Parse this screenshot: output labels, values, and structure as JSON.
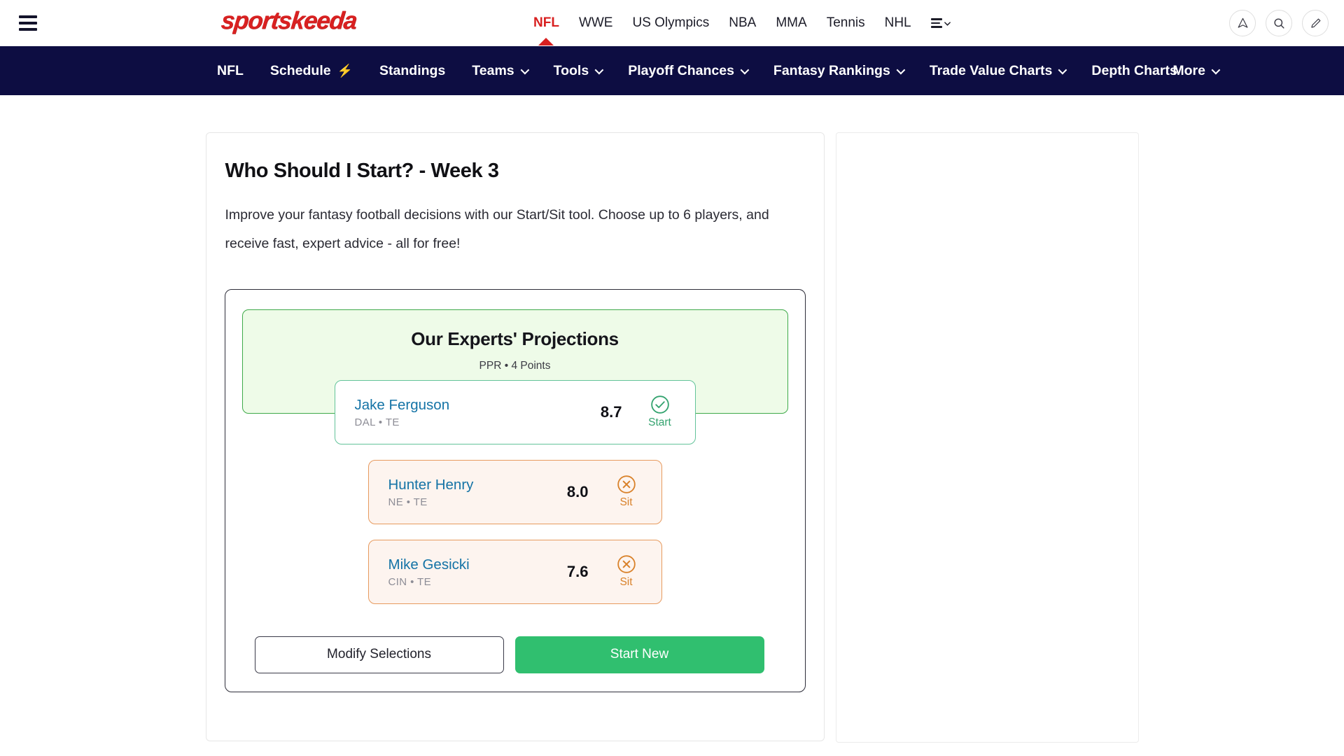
{
  "colors": {
    "brand_red": "#d92121",
    "navy": "#0d0d42",
    "green_accent": "#3faa4a",
    "green_button": "#30bf6f",
    "sit_orange": "#d9822b",
    "player_link_blue": "#1473a6"
  },
  "topbar": {
    "menu_icon": "hamburger-icon",
    "logo_text": "sportskeeda",
    "nav": [
      {
        "label": "NFL",
        "active": true
      },
      {
        "label": "WWE",
        "active": false
      },
      {
        "label": "US Olympics",
        "active": false
      },
      {
        "label": "NBA",
        "active": false
      },
      {
        "label": "MMA",
        "active": false
      },
      {
        "label": "Tennis",
        "active": false
      },
      {
        "label": "NHL",
        "active": false
      }
    ],
    "more_list_icon": "list-chevron-icon",
    "icons": [
      {
        "name": "notifications-icon",
        "glyph": "send"
      },
      {
        "name": "search-icon",
        "glyph": "search"
      },
      {
        "name": "write-icon",
        "glyph": "pencil"
      }
    ]
  },
  "navbar": {
    "items": [
      {
        "label": "NFL",
        "has_dropdown": false,
        "badge": ""
      },
      {
        "label": "Schedule",
        "has_dropdown": false,
        "badge": "⚡"
      },
      {
        "label": "Standings",
        "has_dropdown": false,
        "badge": ""
      },
      {
        "label": "Teams",
        "has_dropdown": true,
        "badge": ""
      },
      {
        "label": "Tools",
        "has_dropdown": true,
        "badge": ""
      },
      {
        "label": "Playoff Chances",
        "has_dropdown": true,
        "badge": ""
      },
      {
        "label": "Fantasy Rankings",
        "has_dropdown": true,
        "badge": ""
      },
      {
        "label": "Trade Value Charts",
        "has_dropdown": true,
        "badge": ""
      },
      {
        "label": "Depth Charts",
        "has_dropdown": false,
        "badge": ""
      }
    ],
    "more": {
      "label": "More",
      "has_dropdown": true
    }
  },
  "main": {
    "title": "Who Should I Start? - Week 3",
    "subtitle": "Improve your fantasy football decisions with our Start/Sit tool. Choose up to 6 players, and receive fast, expert advice - all for free!",
    "projections": {
      "heading": "Our Experts' Projections",
      "meta": "PPR • 4 Points",
      "players": [
        {
          "name": "Jake Ferguson",
          "team": "DAL",
          "position": "TE",
          "team_pos": "DAL • TE",
          "score": "8.7",
          "verdict": "Start",
          "verdict_icon": "check-circle-icon"
        },
        {
          "name": "Hunter Henry",
          "team": "NE",
          "position": "TE",
          "team_pos": "NE • TE",
          "score": "8.0",
          "verdict": "Sit",
          "verdict_icon": "x-circle-icon"
        },
        {
          "name": "Mike Gesicki",
          "team": "CIN",
          "position": "TE",
          "team_pos": "CIN • TE",
          "score": "7.6",
          "verdict": "Sit",
          "verdict_icon": "x-circle-icon"
        }
      ]
    },
    "buttons": {
      "modify": "Modify Selections",
      "start_new": "Start New"
    }
  }
}
